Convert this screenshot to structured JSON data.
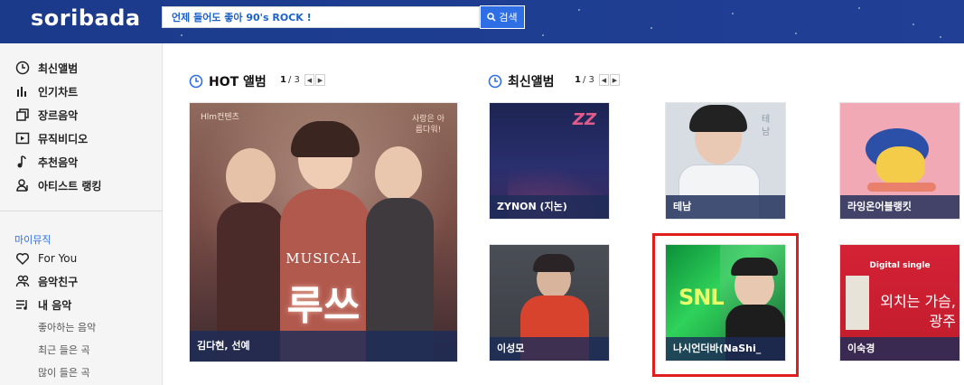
{
  "header": {
    "logo": "soribada",
    "search_value": "언제 들어도 좋아 90's ROCK !",
    "search_button": "검색"
  },
  "sidebar": {
    "items": [
      {
        "label": "최신앨범",
        "icon": "new-clock-icon"
      },
      {
        "label": "인기차트",
        "icon": "chart-bars-icon"
      },
      {
        "label": "장르음악",
        "icon": "layers-icon"
      },
      {
        "label": "뮤직비디오",
        "icon": "play-icon"
      },
      {
        "label": "추천음악",
        "icon": "music-note-icon"
      },
      {
        "label": "아티스트 랭킹",
        "icon": "user-rank-icon"
      }
    ],
    "section": "마이뮤직",
    "my_items": [
      {
        "label": "For You",
        "icon": "heart-icon"
      },
      {
        "label": "음악친구",
        "icon": "friends-icon"
      },
      {
        "label": "내 음악",
        "icon": "playlist-icon"
      }
    ],
    "sub_items": [
      "좋아하는 음악",
      "최근 들은 곡",
      "많이 들은 곡"
    ]
  },
  "hot": {
    "title": "HOT 앨범",
    "page_current": "1",
    "page_total": "/ 3",
    "album": {
      "artist": "김다현, 선예",
      "brand_text": "Hlm컨텐츠",
      "tagline": "사랑은 아름다워!",
      "musical_text": "MUSICAL",
      "title_text": "루쓰"
    }
  },
  "new": {
    "title": "최신앨범",
    "page_current": "1",
    "page_total": "/ 3",
    "albums": [
      {
        "artist": "ZYNON (지논)",
        "art_text": "ZZ"
      },
      {
        "artist": "테남",
        "art_text": "테남"
      },
      {
        "artist": "라잉온어블랭킷",
        "art_text": ""
      },
      {
        "artist": "이성모",
        "art_text": ""
      },
      {
        "artist": "나시언더바(NaShi_",
        "art_text": "SNL"
      },
      {
        "artist": "이숙경",
        "art_text": "외치는 가슴, 광주",
        "top_text": "Digital single"
      }
    ]
  },
  "colors": {
    "header_bg": "#1d3d90",
    "accent": "#2f6fe6",
    "label_bg": "#1c2c58",
    "highlight": "#e01e1e"
  }
}
